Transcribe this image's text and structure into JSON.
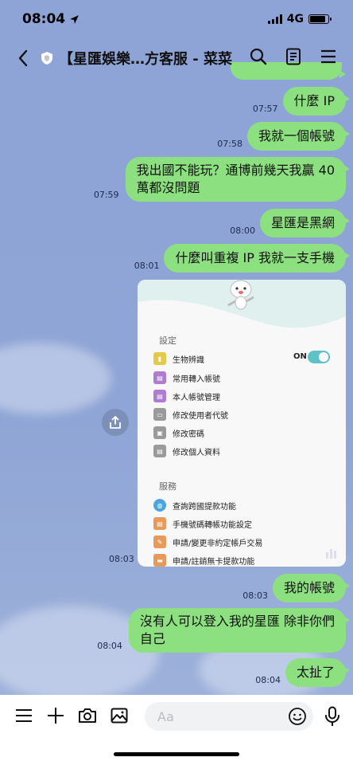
{
  "status_bar": {
    "time": "08:04",
    "network": "4G"
  },
  "header": {
    "title": "【星匯娛樂…方客服 - 菜菜"
  },
  "messages": [
    {
      "time": "07:57",
      "text": "什麼 IP"
    },
    {
      "time": "07:58",
      "text": "我就一個帳號"
    },
    {
      "time": "07:59",
      "line1": "我出國不能玩？通博前幾天我贏 40",
      "line2": "萬都沒問題"
    },
    {
      "time": "08:00",
      "text": "星匯是黑網"
    },
    {
      "time": "08:01",
      "text": "什麼叫重複 IP 我就一支手機"
    },
    {
      "time": "08:03"
    },
    {
      "time": "08:03",
      "text": "我的帳號"
    },
    {
      "time": "08:04",
      "line1": "沒有人可以登入我的星匯 除非你們",
      "line2": "自己"
    },
    {
      "time": "08:04",
      "text": "太扯了"
    }
  ],
  "shared_image": {
    "settings_header": "設定",
    "toggle_label": "ON",
    "settings_items": [
      "生物辨識",
      "常用轉入帳號",
      "本人帳號管理",
      "修改使用者代號",
      "修改密碼",
      "修改個人資料"
    ],
    "services_header": "服務",
    "service_items": [
      "查詢跨國提款功能",
      "手機號碼轉帳功能設定",
      "申請/變更非約定帳戶交易",
      "申請/註銷無卡提款功能"
    ]
  },
  "input": {
    "placeholder": "Aa"
  },
  "colors": {
    "bubble": "#8de080",
    "background": "#8da3d4",
    "toggle": "#5fc2c4"
  }
}
